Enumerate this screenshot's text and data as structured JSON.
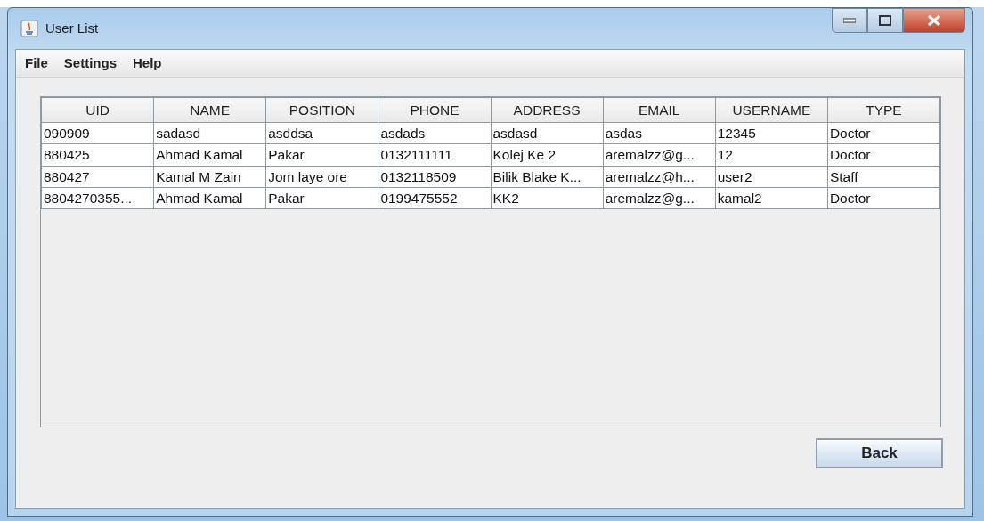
{
  "window": {
    "title": "User List"
  },
  "menu": [
    "File",
    "Settings",
    "Help"
  ],
  "table": {
    "columns": [
      "UID",
      "NAME",
      "POSITION",
      "PHONE",
      "ADDRESS",
      "EMAIL",
      "USERNAME",
      "TYPE"
    ],
    "rows": [
      [
        "090909",
        "sadasd",
        "asddsa",
        "asdads",
        "asdasd",
        "asdas",
        "12345",
        "Doctor"
      ],
      [
        "880425",
        "Ahmad Kamal",
        "Pakar",
        "0132111111",
        "Kolej Ke 2",
        "aremalzz@g...",
        "12",
        "Doctor"
      ],
      [
        "880427",
        "Kamal M Zain",
        "Jom laye ore",
        "0132118509",
        "Bilik Blake K...",
        "aremalzz@h...",
        "user2",
        "Staff"
      ],
      [
        "8804270355...",
        "Ahmad Kamal",
        "Pakar",
        "0199475552",
        "KK2",
        "aremalzz@g...",
        "kamal2",
        "Doctor"
      ]
    ]
  },
  "buttons": [
    "Back"
  ]
}
